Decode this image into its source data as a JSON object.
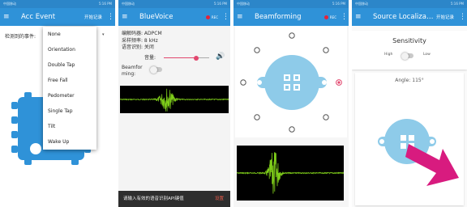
{
  "panel1": {
    "status": {
      "left": "中国移动",
      "right": "5:16 PM"
    },
    "appbar": {
      "menu_icon": "≡",
      "title": "Acc Event",
      "action": "开始记录",
      "more_icon": "⋮"
    },
    "label": "检测到的事件:",
    "dropdown_arrow": "▾",
    "dropdown_options": [
      "None",
      "Orientation",
      "Double Tap",
      "Free Fall",
      "Pedometer",
      "Single Tap",
      "Tilt",
      "Wake Up"
    ]
  },
  "panel2": {
    "status": {
      "left": "中国移动",
      "right": "5:16 PM"
    },
    "appbar": {
      "menu_icon": "≡",
      "title": "BlueVoice",
      "rec": "REC",
      "more_icon": "⋮"
    },
    "info": [
      "编解码器: ADPCM",
      "采样频率: 8 kHz",
      "语音识别: 关闭"
    ],
    "volume_label": "音量:",
    "volume_level": 0.72,
    "speaker_icon": "🔊",
    "beamforming_label_1": "Beamfor",
    "beamforming_label_2": "ming:",
    "toast_text": "请输入有效的语音识别API键值",
    "toast_action": "设置"
  },
  "panel3": {
    "status": {
      "left": "中国移动",
      "right": "5:16 PM"
    },
    "appbar": {
      "menu_icon": "≡",
      "title": "Beamforming",
      "rec": "REC",
      "more_icon": "⋮"
    }
  },
  "panel4": {
    "status": {
      "left": "中国移动",
      "right": "5:16 PM"
    },
    "appbar": {
      "menu_icon": "≡",
      "title": "Source Localiza…",
      "action": "开始记录",
      "more_icon": "⋮"
    },
    "sensitivity_title": "Sensitivity",
    "high_label": "High",
    "low_label": "Low",
    "angle_text": "Angle: 115°"
  },
  "colors": {
    "appbar": "#2f92d8",
    "statusbar": "#2c86c9",
    "accent": "#e2476e",
    "board": "#8ecbe9",
    "arrow": "#d81b7f",
    "wave": "#7fce1a"
  }
}
